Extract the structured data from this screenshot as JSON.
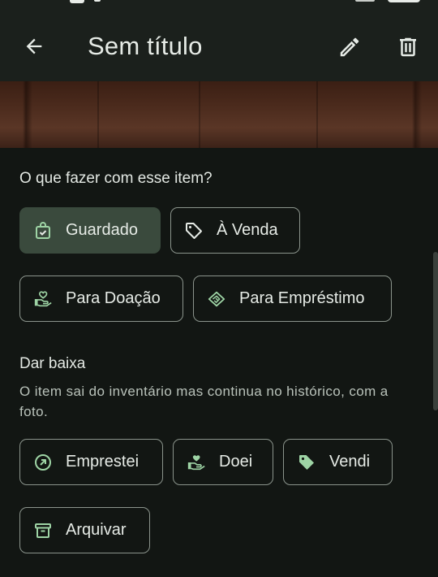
{
  "appbar": {
    "title": "Sem título",
    "back_icon": "arrow-left-icon",
    "edit_icon": "pencil-icon",
    "delete_icon": "trash-icon"
  },
  "status_section": {
    "title": "O que fazer com esse item?",
    "options": [
      {
        "label": "Guardado",
        "icon": "bag-check-icon",
        "selected": true
      },
      {
        "label": "À Venda",
        "icon": "tag-outline-icon",
        "selected": false
      },
      {
        "label": "Para Doação",
        "icon": "hand-heart-icon",
        "selected": false
      },
      {
        "label": "Para Empréstimo",
        "icon": "handshake-icon",
        "selected": false
      }
    ]
  },
  "dar_baixa": {
    "title": "Dar baixa",
    "description": "O item sai do inventário mas continua no histórico, com a foto.",
    "actions": [
      {
        "label": "Emprestei",
        "icon": "arrow-circle-icon"
      },
      {
        "label": "Doei",
        "icon": "hand-heart-icon"
      },
      {
        "label": "Vendi",
        "icon": "tag-filled-icon"
      },
      {
        "label": "Arquivar",
        "icon": "archive-icon"
      }
    ]
  },
  "colors": {
    "background": "#121613",
    "appbar": "#1b201c",
    "accent": "#9ed4a5",
    "chip_border": "#8b948c",
    "chip_selected": "#3a4a3d"
  }
}
